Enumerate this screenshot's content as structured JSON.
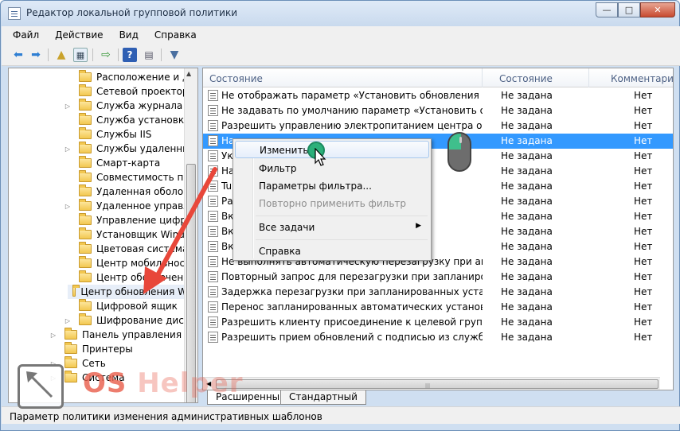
{
  "window": {
    "title": "Редактор локальной групповой политики",
    "btn_min": "—",
    "btn_max": "□",
    "btn_close": "✕"
  },
  "menu": [
    "Файл",
    "Действие",
    "Вид",
    "Справка"
  ],
  "toolbar_icons": [
    "back-arrow-icon",
    "forward-arrow-icon",
    "up-folder-icon",
    "show-hide-tree-icon",
    "export-list-icon",
    "help-icon",
    "properties-icon",
    "filter-icon"
  ],
  "tree": [
    {
      "label": "Расположение и датч",
      "expandable": false
    },
    {
      "label": "Сетевой проектор",
      "expandable": false
    },
    {
      "label": "Служба журнала собы",
      "expandable": true
    },
    {
      "label": "Служба установки Ac",
      "expandable": false
    },
    {
      "label": "Службы IIS",
      "expandable": false
    },
    {
      "label": "Службы удаленных р",
      "expandable": true
    },
    {
      "label": "Смарт-карта",
      "expandable": false
    },
    {
      "label": "Совместимость прил",
      "expandable": false
    },
    {
      "label": "Удаленная оболочка",
      "expandable": false
    },
    {
      "label": "Удаленное управлен",
      "expandable": true
    },
    {
      "label": "Управление цифров",
      "expandable": false
    },
    {
      "label": "Установщик Windo",
      "expandable": false
    },
    {
      "label": "Цветовая система Wi",
      "expandable": false
    },
    {
      "label": "Центр мобильности W",
      "expandable": false
    },
    {
      "label": "Центр обеспечения б",
      "expandable": false
    },
    {
      "label": "Центр обновления W",
      "expandable": false,
      "selected": true
    },
    {
      "label": "Цифровой ящик",
      "expandable": false
    },
    {
      "label": "Шифрование диска Bi",
      "expandable": true
    },
    {
      "label": "Панель управления",
      "expandable": true,
      "level": 1
    },
    {
      "label": "Принтеры",
      "expandable": false,
      "level": 1
    },
    {
      "label": "Сеть",
      "expandable": true,
      "level": 1
    },
    {
      "label": "Система",
      "expandable": true,
      "level": 1
    }
  ],
  "list": {
    "headers": {
      "col1": "Состояние",
      "col2": "Состояние",
      "col3": "Комментарий"
    },
    "rows": [
      {
        "name": "Не отображать параметр «Установить обновления и заве...",
        "state": "Не задана",
        "comment": "Нет"
      },
      {
        "name": "Не задавать по умолчанию параметр «Установить обнов...",
        "state": "Не задана",
        "comment": "Нет"
      },
      {
        "name": "Разрешить управлению электропитанием центра обнов...",
        "state": "Не задана",
        "comment": "Нет"
      },
      {
        "name": "На",
        "state": "Не задана",
        "comment": "Нет",
        "selected": true
      },
      {
        "name": "Ук",
        "state": "Не задана",
        "comment": "Нет"
      },
      {
        "name": "На",
        "state": "Не задана",
        "comment": "Нет"
      },
      {
        "name": "Tu                                              ws throu...",
        "state": "Не задана",
        "comment": "Нет"
      },
      {
        "name": "Ра                                              инистра...",
        "state": "Не задана",
        "comment": "Нет"
      },
      {
        "name": "Вк",
        "state": "Не задана",
        "comment": "Нет"
      },
      {
        "name": "Вк                                              ских обн...",
        "state": "Не задана",
        "comment": "Нет"
      },
      {
        "name": "Вк                                              енных о...",
        "state": "Не задана",
        "comment": "Нет"
      },
      {
        "name": "Не выполнять автоматическую перезагрузку при автома...",
        "state": "Не задана",
        "comment": "Нет"
      },
      {
        "name": "Повторный запрос для перезагрузки при запланированн...",
        "state": "Не задана",
        "comment": "Нет"
      },
      {
        "name": "Задержка перезагрузки при запланированных установках",
        "state": "Не задана",
        "comment": "Нет"
      },
      {
        "name": "Перенос запланированных автоматических установок об...",
        "state": "Не задана",
        "comment": "Нет"
      },
      {
        "name": "Разрешить клиенту присоединение к целевой группе",
        "state": "Не задана",
        "comment": "Нет"
      },
      {
        "name": "Разрешить прием обновлений с подписью из службы об...",
        "state": "Не задана",
        "comment": "Нет"
      }
    ]
  },
  "context_menu": {
    "items": [
      {
        "label": "Изменить",
        "highlighted": true
      },
      {
        "label": "Фильтр"
      },
      {
        "label": "Параметры фильтра..."
      },
      {
        "label": "Повторно применить фильтр",
        "disabled": true
      },
      {
        "label": "Все задачи",
        "submenu": true
      },
      {
        "label": "Справка"
      }
    ],
    "submenu_arrow": "▶"
  },
  "tabs": [
    "Расширенный",
    "Стандартный"
  ],
  "status": "Параметр политики изменения административных шаблонов",
  "watermark": {
    "part1": "OS",
    "part2": " Helper"
  },
  "colors": {
    "selection": "#3399ff",
    "arrow": "#e8473a",
    "accent_green": "#2bb07a"
  }
}
